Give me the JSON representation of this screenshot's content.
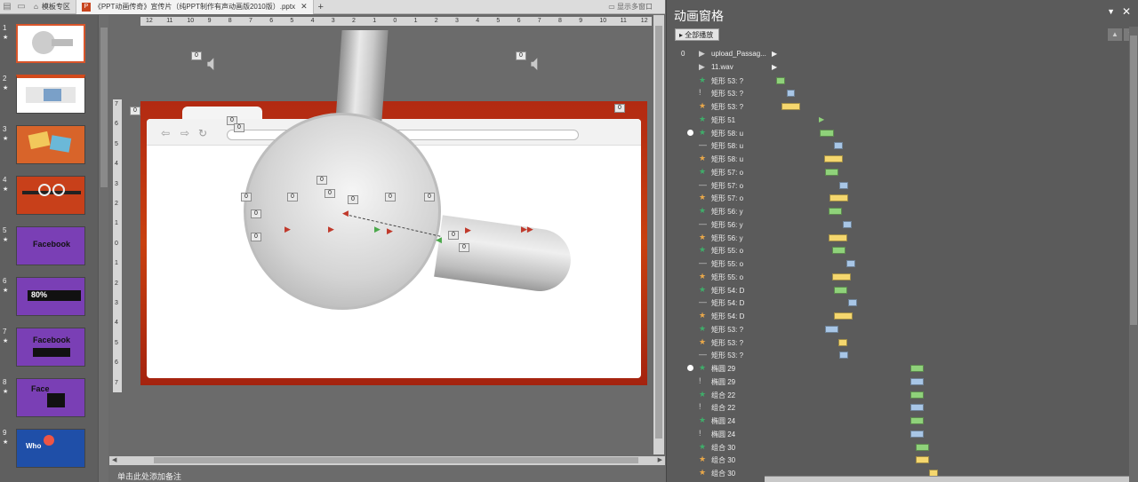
{
  "tabs": [
    {
      "label": "模板专区",
      "active": false
    },
    {
      "label": "《PPT动画传奇》宣传片（纯PPT制作有声动画版2010版）.pptx",
      "active": true,
      "badge": "P"
    }
  ],
  "tab_right": "显示多窗口",
  "thumbnails": [
    {
      "num": "1",
      "star": "★"
    },
    {
      "num": "2",
      "star": "★"
    },
    {
      "num": "3",
      "star": "★"
    },
    {
      "num": "4",
      "star": "★"
    },
    {
      "num": "5",
      "star": "★",
      "caption": "Facebook"
    },
    {
      "num": "6",
      "star": "★",
      "caption": "80%"
    },
    {
      "num": "7",
      "star": "★",
      "caption": "Facebook"
    },
    {
      "num": "8",
      "star": "★",
      "caption": "Face"
    },
    {
      "num": "9",
      "star": "★",
      "caption": "Who"
    }
  ],
  "ruler_h": [
    "12",
    "11",
    "10",
    "9",
    "8",
    "7",
    "6",
    "5",
    "4",
    "3",
    "2",
    "1",
    "0",
    "1",
    "2",
    "3",
    "4",
    "5",
    "6",
    "7",
    "8",
    "9",
    "10",
    "11",
    "12"
  ],
  "ruler_v": [
    "7",
    "6",
    "5",
    "4",
    "3",
    "2",
    "1",
    "0",
    "1",
    "2",
    "3",
    "4",
    "5",
    "6",
    "7"
  ],
  "slide_tags": [
    "0",
    "0",
    "0",
    "0",
    "0",
    "0",
    "0",
    "0",
    "0",
    "0",
    "0",
    "0",
    "0",
    "0",
    "0",
    "0",
    "0"
  ],
  "notes_placeholder": "单击此处添加备注",
  "anim_pane": {
    "title": "动画窗格",
    "play_all": "全部播放",
    "colors": {
      "green": "#8fd27a",
      "blue": "#a8c6e6",
      "yellow": "#f5d76e",
      "star": "#e9a84a",
      "entrance": "#3fae6a"
    },
    "rows": [
      {
        "step": "0",
        "label": "upload_Passag...",
        "icon": "▶",
        "bar": "tri"
      },
      {
        "label": "11.wav",
        "icon": "▶",
        "bar": "tri"
      },
      {
        "label": "矩形 53: ?",
        "icon": "★",
        "bar": "green"
      },
      {
        "label": "矩形 53: ?",
        "icon": "!",
        "bar": "blue"
      },
      {
        "label": "矩形 53: ?",
        "icon": "★",
        "bar": "yellow"
      },
      {
        "label": "矩形 51",
        "icon": "★",
        "bar": "tri-green"
      },
      {
        "label": "矩形 58: u",
        "icon": "★",
        "bar": "green",
        "clock": true
      },
      {
        "label": "矩形 58: u",
        "icon": "—",
        "bar": "blue"
      },
      {
        "label": "矩形 58: u",
        "icon": "★",
        "bar": "yellow"
      },
      {
        "label": "矩形 57: o",
        "icon": "★",
        "bar": "green"
      },
      {
        "label": "矩形 57: o",
        "icon": "—",
        "bar": "blue"
      },
      {
        "label": "矩形 57: o",
        "icon": "★",
        "bar": "yellow"
      },
      {
        "label": "矩形 56: y",
        "icon": "★",
        "bar": "green"
      },
      {
        "label": "矩形 56: y",
        "icon": "—",
        "bar": "blue"
      },
      {
        "label": "矩形 56: y",
        "icon": "★",
        "bar": "yellow"
      },
      {
        "label": "矩形 55: o",
        "icon": "★",
        "bar": "green"
      },
      {
        "label": "矩形 55: o",
        "icon": "—",
        "bar": "blue"
      },
      {
        "label": "矩形 55: o",
        "icon": "★",
        "bar": "yellow"
      },
      {
        "label": "矩形 54: D",
        "icon": "★",
        "bar": "green"
      },
      {
        "label": "矩形 54: D",
        "icon": "—",
        "bar": "blue"
      },
      {
        "label": "矩形 54: D",
        "icon": "★",
        "bar": "yellow"
      },
      {
        "label": "矩形 53: ?",
        "icon": "★",
        "bar": "blue"
      },
      {
        "label": "矩形 53: ?",
        "icon": "★",
        "bar": "yellow"
      },
      {
        "label": "矩形 53: ?",
        "icon": "—",
        "bar": "blue"
      },
      {
        "label": "椭圆 29",
        "icon": "★",
        "bar": "green",
        "clock": true
      },
      {
        "label": "椭圆 29",
        "icon": "!",
        "bar": "blue"
      },
      {
        "label": "组合 22",
        "icon": "★",
        "bar": "green"
      },
      {
        "label": "组合 22",
        "icon": "!",
        "bar": "blue"
      },
      {
        "label": "椭圆 24",
        "icon": "★",
        "bar": "green"
      },
      {
        "label": "椭圆 24",
        "icon": "!",
        "bar": "blue"
      },
      {
        "label": "组合 30",
        "icon": "★",
        "bar": "green"
      },
      {
        "label": "组合 30",
        "icon": "★",
        "bar": "yellow"
      },
      {
        "label": "组合 30",
        "icon": "★",
        "bar": "yellow"
      }
    ]
  }
}
